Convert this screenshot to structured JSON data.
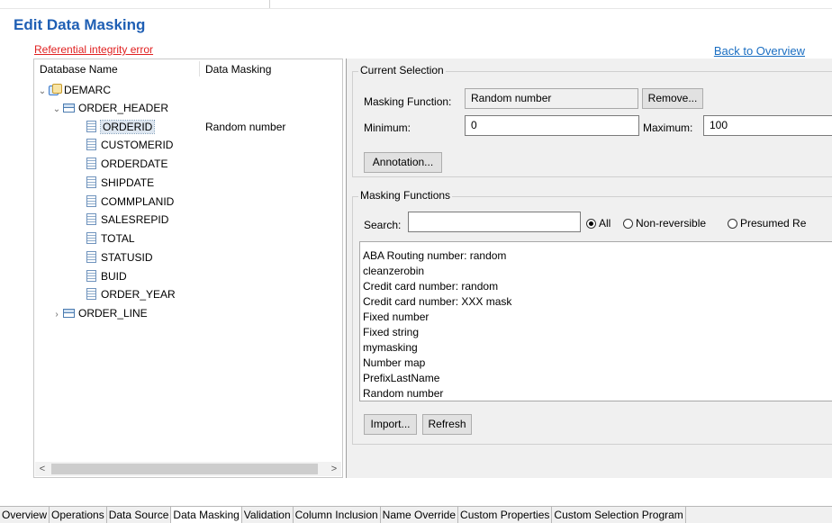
{
  "title": "Edit Data Masking",
  "error_link": "Referential integrity error",
  "back_link": "Back to Overview",
  "tree": {
    "col_name": "Database Name",
    "col_masking": "Data Masking",
    "root": "DEMARC",
    "table": "ORDER_HEADER",
    "columns": [
      {
        "name": "ORDERID",
        "masking": "Random number"
      },
      {
        "name": "CUSTOMERID",
        "masking": ""
      },
      {
        "name": "ORDERDATE",
        "masking": ""
      },
      {
        "name": "SHIPDATE",
        "masking": ""
      },
      {
        "name": "COMMPLANID",
        "masking": ""
      },
      {
        "name": "SALESREPID",
        "masking": ""
      },
      {
        "name": "TOTAL",
        "masking": ""
      },
      {
        "name": "STATUSID",
        "masking": ""
      },
      {
        "name": "BUID",
        "masking": ""
      },
      {
        "name": "ORDER_YEAR",
        "masking": ""
      }
    ],
    "other_table": "ORDER_LINE",
    "scroll_left": "<",
    "scroll_right": ">"
  },
  "current_selection": {
    "title": "Current Selection",
    "masking_function_label": "Masking Function:",
    "masking_function_value": "Random number",
    "remove_button": "Remove...",
    "minimum_label": "Minimum:",
    "minimum_value": "0",
    "maximum_label": "Maximum:",
    "maximum_value": "100",
    "annotation_button": "Annotation..."
  },
  "masking_functions": {
    "title": "Masking Functions",
    "search_label": "Search:",
    "search_value": "",
    "radio_all": "All",
    "radio_nonreversible": "Non-reversible",
    "radio_presumed": "Presumed Re",
    "selected_radio": "All",
    "items": [
      "ABA Routing number: random",
      "cleanzerobin",
      "Credit card number: random",
      "Credit card number: XXX mask",
      "Fixed number",
      "Fixed string",
      "mymasking",
      "Number map",
      "PrefixLastName",
      "Random number"
    ],
    "import_button": "Import...",
    "refresh_button": "Refresh"
  },
  "tabs": [
    "Overview",
    "Operations",
    "Data Source",
    "Data Masking",
    "Validation",
    "Column Inclusion",
    "Name Override",
    "Custom Properties",
    "Custom Selection Program"
  ],
  "active_tab": "Data Masking",
  "icons": {
    "database": "database-icon",
    "table": "table-icon",
    "column": "column-icon",
    "expand": "chevron-down-icon",
    "collapsed": "chevron-right-icon"
  },
  "colors": {
    "title": "#1f5fb4",
    "error": "#e02020",
    "link": "#1a6ec2",
    "panel_bg": "#f0f0f0",
    "selected_row": "#dde6f0"
  }
}
